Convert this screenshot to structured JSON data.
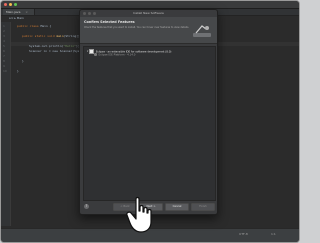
{
  "window": {
    "tab_label": "Main.java",
    "tab_close": "×",
    "breadcrumb": "src ▸ Main"
  },
  "editor": {
    "line_numbers": [
      "1",
      "2",
      "3",
      "4",
      "5",
      "6",
      "7",
      "8",
      "9",
      "10",
      "11",
      "12",
      "13",
      "14",
      "15",
      "16",
      "17"
    ],
    "lines": {
      "l1_kw": "public class",
      "l1_id": " Main {",
      "l2_kw": "public static void",
      "l2_fn": " main",
      "l2_id": "(String[] args) {",
      "l3_id": "System.out.println(",
      "l3_st": "\"Hello\"",
      "l3_end": ");",
      "l4_id": "Scanner in = new Scanner(System.in);",
      "l5_id": "}",
      "l6_id": "}"
    }
  },
  "dialog": {
    "title": "Install New Software",
    "heading": "Confirm Selected Features",
    "subtext": "Check the features that you want to install. You can hover over features to view details.",
    "features": [
      {
        "expander": "▾",
        "label": "Eclipse - an extensible IDE for software development (8.0)",
        "checked": true
      },
      {
        "expander": "",
        "label": "Eclipse IDE Platform - 4.14.0",
        "checked": false
      }
    ],
    "help_icon": "?",
    "buttons": {
      "back": "< Back",
      "next": "Next >",
      "cancel": "Cancel",
      "finish": "Finish"
    }
  },
  "status": {
    "left": "",
    "encoding": "UTF-8",
    "position": "1:1"
  },
  "colors": {
    "accent": "#4a88c7",
    "editor_bg": "#2b2b2b",
    "dialog_bg": "#3a3b3d"
  }
}
